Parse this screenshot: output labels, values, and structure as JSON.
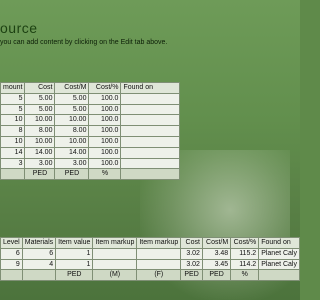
{
  "page": {
    "title_fragment": "ource",
    "hint": "you can add content by clicking on the Edit tab above."
  },
  "top_table": {
    "headers": [
      "mount",
      "Cost",
      "Cost/M",
      "Cost/%",
      "Found on"
    ],
    "rows": [
      [
        "5",
        "5.00",
        "5.00",
        "100.0",
        ""
      ],
      [
        "5",
        "5.00",
        "5.00",
        "100.0",
        ""
      ],
      [
        "10",
        "10.00",
        "10.00",
        "100.0",
        ""
      ],
      [
        "8",
        "8.00",
        "8.00",
        "100.0",
        ""
      ],
      [
        "10",
        "10.00",
        "10.00",
        "100.0",
        ""
      ],
      [
        "14",
        "14.00",
        "14.00",
        "100.0",
        ""
      ],
      [
        "3",
        "3.00",
        "3.00",
        "100.0",
        ""
      ]
    ],
    "units": [
      "",
      "PED",
      "PED",
      "%",
      ""
    ]
  },
  "bottom_table": {
    "headers": [
      "Level",
      "Materials",
      "Item value",
      "Item markup",
      "Item markup",
      "Cost",
      "Cost/M",
      "Cost/%",
      "Found on"
    ],
    "rows": [
      [
        "6",
        "6",
        "1",
        "",
        "",
        "3.02",
        "3.48",
        "115.2",
        "Planet Caly"
      ],
      [
        "9",
        "4",
        "1",
        "",
        "",
        "3.02",
        "3.45",
        "114.2",
        "Planet Caly"
      ]
    ],
    "units": [
      "",
      "",
      "PED",
      "(M)",
      "(F)",
      "PED",
      "PED",
      "%",
      ""
    ]
  }
}
